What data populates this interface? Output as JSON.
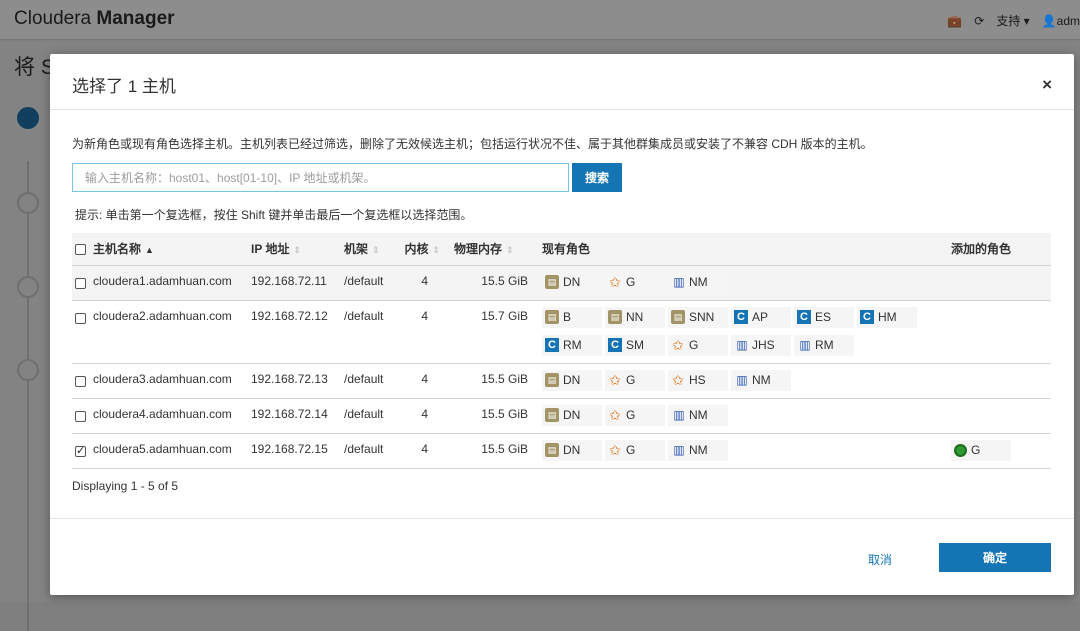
{
  "app": {
    "brand_light": "Cloudera",
    "brand_bold": "Manager",
    "support": "支持",
    "user": "adm",
    "page_title": "将 S"
  },
  "modal": {
    "title": "选择了 1 主机",
    "close": "×",
    "description": "为新角色或现有角色选择主机。主机列表已经过筛选，删除了无效候选主机；包括运行状况不佳、属于其他群集成员或安装了不兼容 CDH 版本的主机。",
    "search_placeholder": "输入主机名称：host01、host[01-10]、IP 地址或机架。",
    "search_button": "搜索",
    "hint": "提示: 单击第一个复选框，按住 Shift 键并单击最后一个复选框以选择范围。",
    "columns": {
      "host": "主机名称",
      "ip": "IP 地址",
      "rack": "机架",
      "cores": "内核",
      "memory": "物理内存",
      "roles": "现有角色",
      "added": "添加的角色"
    },
    "rows": [
      {
        "host": "cloudera1.adamhuan.com",
        "ip": "192.168.72.11",
        "rack": "/default",
        "cores": "4",
        "memory": "15.5 GiB",
        "checked": false,
        "roles": [
          {
            "icon": "hdfs",
            "label": "DN"
          },
          {
            "icon": "star",
            "label": "G"
          },
          {
            "icon": "yarn",
            "label": "NM"
          }
        ],
        "added": []
      },
      {
        "host": "cloudera2.adamhuan.com",
        "ip": "192.168.72.12",
        "rack": "/default",
        "cores": "4",
        "memory": "15.7 GiB",
        "checked": false,
        "roles": [
          {
            "icon": "hdfs",
            "label": "B"
          },
          {
            "icon": "hdfs",
            "label": "NN"
          },
          {
            "icon": "hdfs",
            "label": "SNN"
          },
          {
            "icon": "c",
            "label": "AP"
          },
          {
            "icon": "c",
            "label": "ES"
          },
          {
            "icon": "c",
            "label": "HM"
          },
          {
            "icon": "c",
            "label": "RM"
          },
          {
            "icon": "c",
            "label": "SM"
          },
          {
            "icon": "star",
            "label": "G"
          },
          {
            "icon": "yarn",
            "label": "JHS"
          },
          {
            "icon": "yarn",
            "label": "RM"
          }
        ],
        "added": []
      },
      {
        "host": "cloudera3.adamhuan.com",
        "ip": "192.168.72.13",
        "rack": "/default",
        "cores": "4",
        "memory": "15.5 GiB",
        "checked": false,
        "roles": [
          {
            "icon": "hdfs",
            "label": "DN"
          },
          {
            "icon": "star",
            "label": "G"
          },
          {
            "icon": "star",
            "label": "HS"
          },
          {
            "icon": "yarn",
            "label": "NM"
          }
        ],
        "added": []
      },
      {
        "host": "cloudera4.adamhuan.com",
        "ip": "192.168.72.14",
        "rack": "/default",
        "cores": "4",
        "memory": "15.5 GiB",
        "checked": false,
        "roles": [
          {
            "icon": "hdfs",
            "label": "DN"
          },
          {
            "icon": "star",
            "label": "G"
          },
          {
            "icon": "yarn",
            "label": "NM"
          }
        ],
        "added": []
      },
      {
        "host": "cloudera5.adamhuan.com",
        "ip": "192.168.72.15",
        "rack": "/default",
        "cores": "4",
        "memory": "15.5 GiB",
        "checked": true,
        "roles": [
          {
            "icon": "hdfs",
            "label": "DN"
          },
          {
            "icon": "star",
            "label": "G"
          },
          {
            "icon": "yarn",
            "label": "NM"
          }
        ],
        "added": [
          {
            "icon": "g",
            "label": "G"
          }
        ]
      }
    ],
    "footer_text": "Displaying 1 - 5 of 5",
    "cancel": "取消",
    "ok": "确定"
  }
}
